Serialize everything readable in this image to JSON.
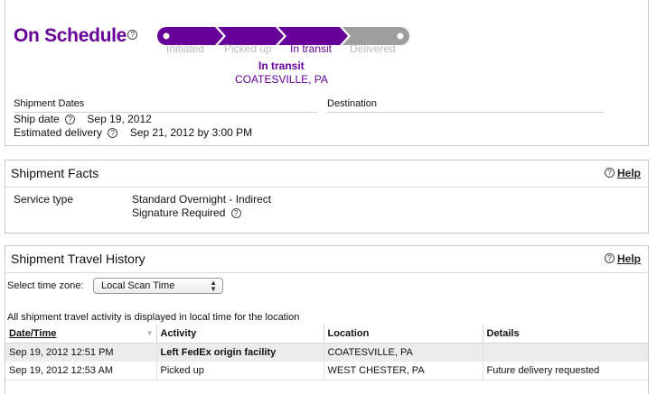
{
  "status": {
    "title": "On Schedule",
    "current_status": "In transit",
    "current_location": "COATESVILLE, PA",
    "progress_steps": [
      "Initiated",
      "Picked up",
      "In transit",
      "Delivered"
    ],
    "current_step_index": 2,
    "colors": {
      "accent": "#660099",
      "pending": "#999999"
    }
  },
  "dates": {
    "section_label": "Shipment Dates",
    "destination_label": "Destination",
    "ship_date_label": "Ship date",
    "ship_date_value": "Sep 19, 2012",
    "est_delivery_label": "Estimated delivery",
    "est_delivery_value": "Sep 21, 2012 by 3:00 PM"
  },
  "facts": {
    "title": "Shipment Facts",
    "help": "Help",
    "service_type_label": "Service type",
    "service_type_value": "Standard Overnight - Indirect",
    "signature": "Signature Required"
  },
  "history": {
    "title": "Shipment Travel History",
    "help": "Help",
    "timezone_label": "Select time zone:",
    "timezone_value": "Local Scan Time",
    "note": "All shipment travel activity is displayed in local time for the location",
    "columns": [
      "Date/Time",
      "Activity",
      "Location",
      "Details"
    ],
    "rows": [
      {
        "datetime": "Sep 19, 2012 12:51 PM",
        "activity": "Left FedEx origin facility",
        "location": "COATESVILLE, PA",
        "details": ""
      },
      {
        "datetime": "Sep 19, 2012 12:53 AM",
        "activity": "Picked up",
        "location": "WEST CHESTER, PA",
        "details": "Future delivery requested"
      }
    ]
  }
}
